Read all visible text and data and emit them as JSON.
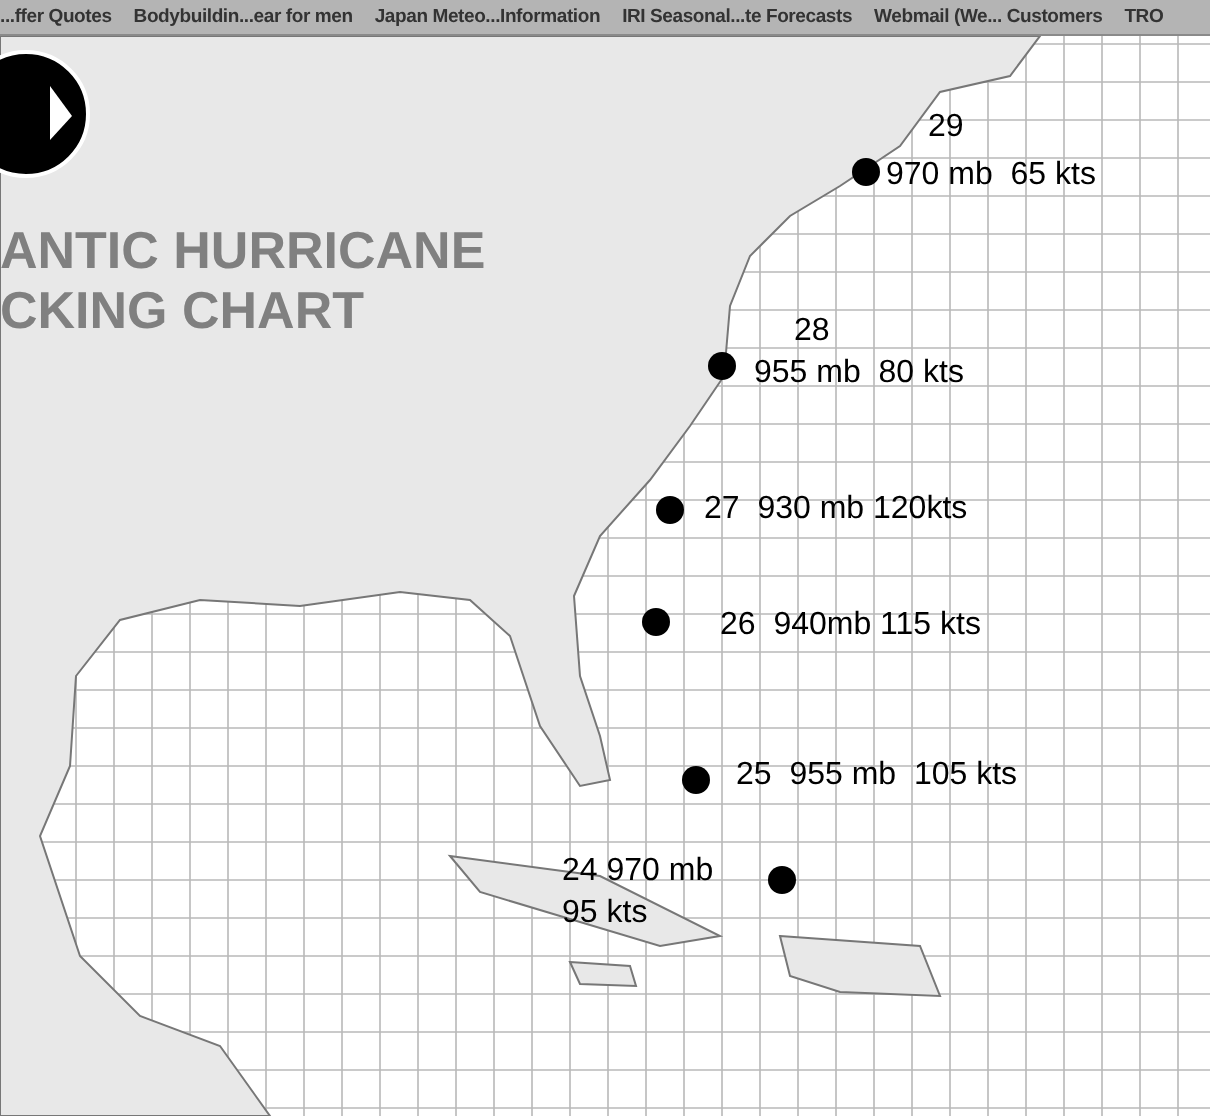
{
  "bookmarks": [
    {
      "label": "...ffer Quotes"
    },
    {
      "label": "Bodybuildin...ear for men"
    },
    {
      "label": "Japan Meteo...Information"
    },
    {
      "label": "IRI Seasonal...te Forecasts"
    },
    {
      "label": "Webmail (We... Customers"
    },
    {
      "label": "TRO"
    }
  ],
  "chart": {
    "title_lines": [
      "ANTIC HURRICANE",
      "CKING CHART"
    ],
    "positions": [
      {
        "lines": [
          "29",
          "970 mb  65 kts"
        ]
      },
      {
        "lines": [
          "28",
          "955 mb  80 kts"
        ]
      },
      {
        "lines": [
          "27  930 mb 120kts"
        ]
      },
      {
        "lines": [
          "26  940mb 115 kts"
        ]
      },
      {
        "lines": [
          "25  955 mb  105 kts"
        ]
      },
      {
        "lines": [
          "24 970 mb",
          "95 kts"
        ]
      }
    ]
  }
}
